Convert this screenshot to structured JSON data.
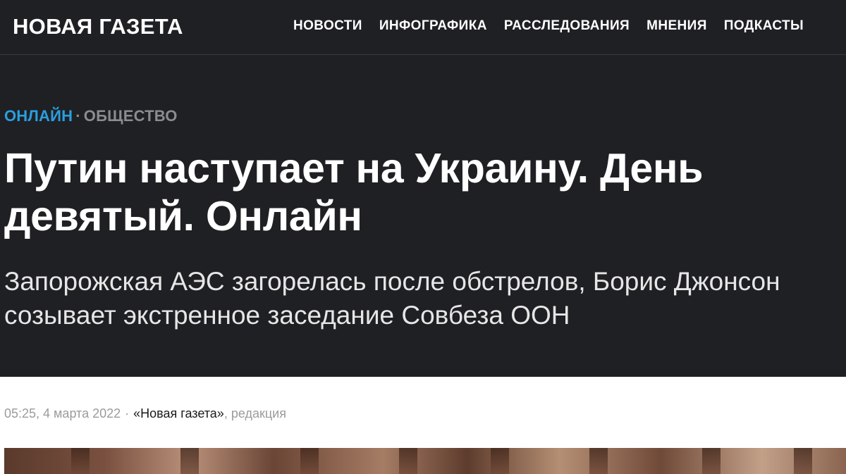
{
  "site": {
    "logo": "НОВАЯ ГАЗЕТА"
  },
  "nav": {
    "items": [
      "НОВОСТИ",
      "ИНФОГРАФИКА",
      "РАССЛЕДОВАНИЯ",
      "МНЕНИЯ",
      "ПОДКАСТЫ"
    ]
  },
  "article": {
    "rubric_online": "ОНЛАЙН",
    "rubric_sep": "·",
    "rubric_section": "ОБЩЕСТВО",
    "headline": "Путин наступает на Украину. День девятый. Онлайн",
    "lead": "Запорожская АЭС загорелась после обстрелов, Борис Джонсон созывает экстренное заседание Совбеза ООН",
    "date": "05:25, 4 марта 2022",
    "meta_sep": "·",
    "author": "«Новая газета»",
    "role": ", редакция"
  },
  "colors": {
    "header_bg": "#1f2023",
    "accent": "#2a9ee0",
    "muted": "#8a8c90"
  }
}
